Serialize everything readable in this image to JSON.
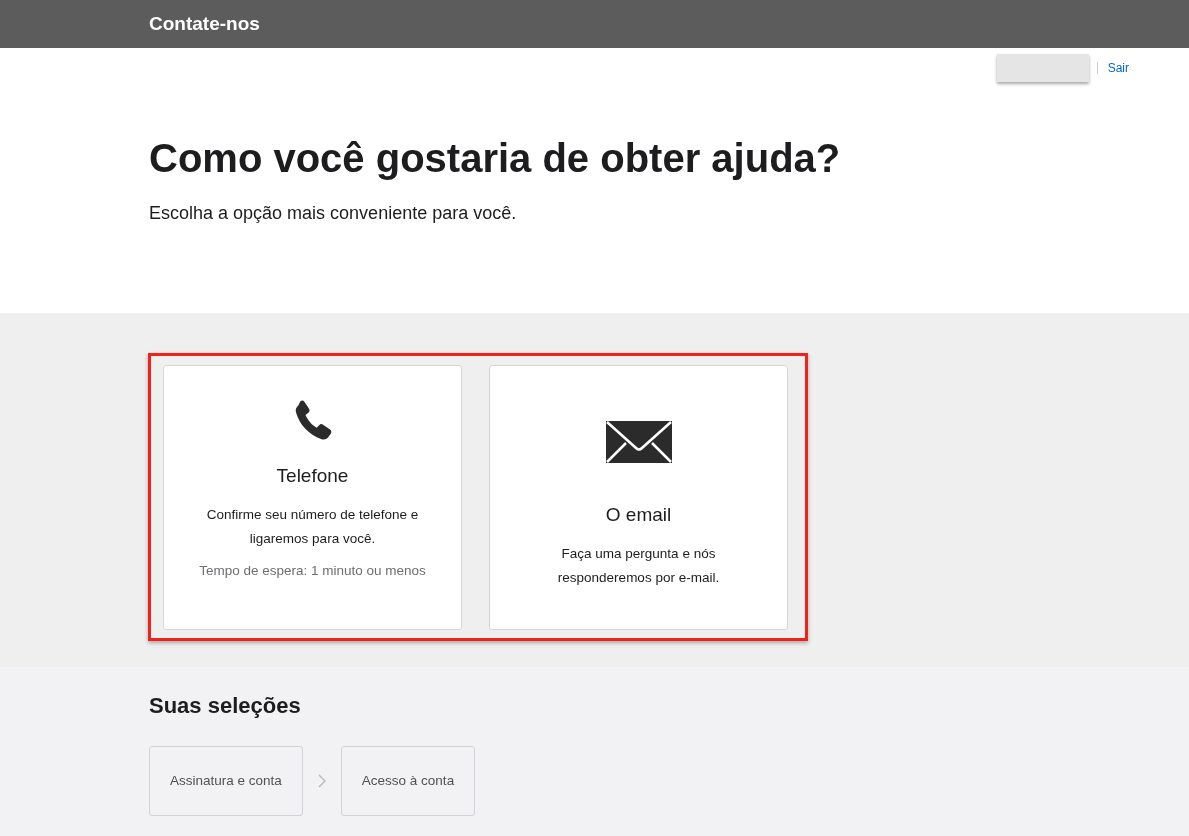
{
  "header": {
    "title": "Contate-nos"
  },
  "account": {
    "signout": "Sair"
  },
  "intro": {
    "heading": "Como você gostaria de obter ajuda?",
    "subtitle": "Escolha a opção mais conveniente para você."
  },
  "options": [
    {
      "kind": "phone",
      "title": "Telefone",
      "description": "Confirme seu número de telefone e ligaremos para você.",
      "note": "Tempo de espera: 1 minuto ou menos"
    },
    {
      "kind": "email",
      "title": "O email",
      "description": "Faça uma pergunta e nós responderemos por e-mail."
    }
  ],
  "selections": {
    "heading": "Suas seleções",
    "steps": [
      "Assinatura e conta",
      "Acesso à conta"
    ]
  }
}
